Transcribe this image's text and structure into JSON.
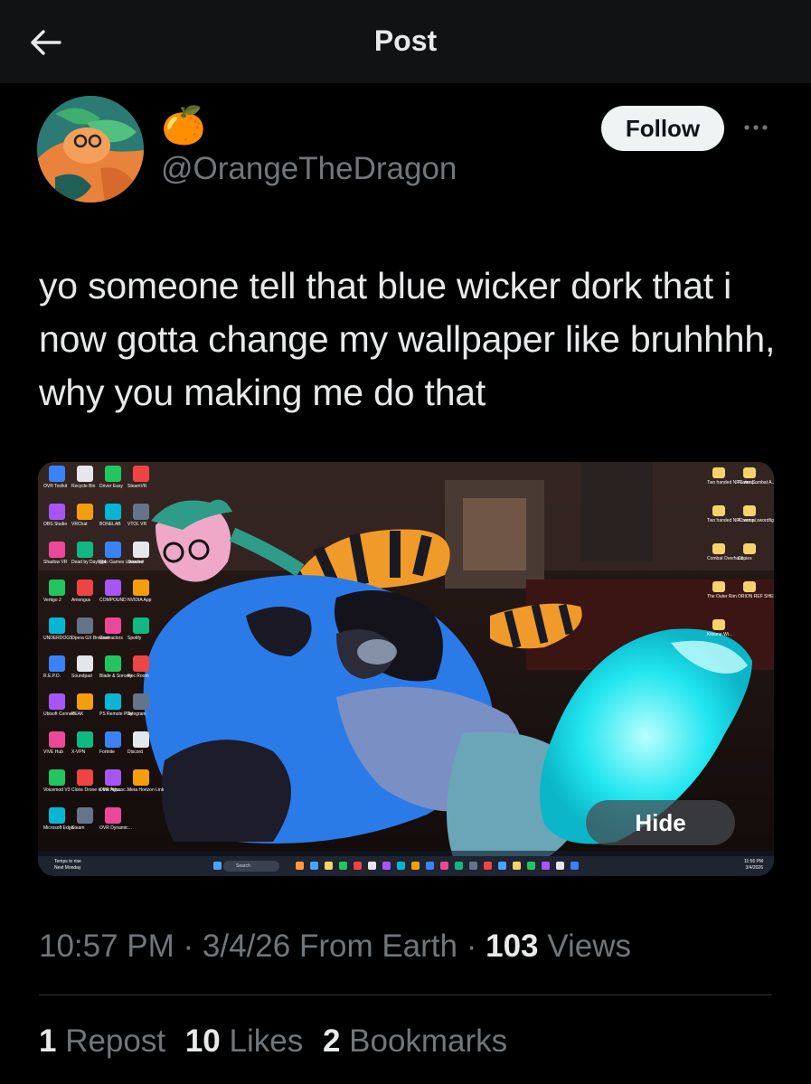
{
  "header": {
    "title": "Post",
    "back_icon": "arrow-left-icon"
  },
  "author": {
    "display_emoji": "🍊",
    "handle": "@OrangeTheDragon",
    "follow_label": "Follow",
    "more_icon": "more-horizontal-icon"
  },
  "post": {
    "text": "yo someone tell that blue wicker dork that i now gotta change my wallpaper like bruhhhh, why you making me do that",
    "media": {
      "hide_label": "Hide",
      "taskbar": {
        "search": "Search",
        "weather_line1": "Temps to rise",
        "weather_line2": "Next Monday",
        "clock_time": "11:56 PM",
        "clock_date": "3/4/2026"
      },
      "desktop_icons_left": [
        [
          "OVR Toolkit",
          "Recycle Bin",
          "Driver Easy",
          "SteamVR"
        ],
        [
          "OBS Studio",
          "VRChat",
          "BONELAB",
          "VTOL VR"
        ],
        [
          "Shadow VR",
          "Dead by Daylight",
          "Epic Games Launcher",
          "Onward"
        ],
        [
          "Vertigo 2",
          "Amongus",
          "COMPOUND",
          "NVIDIA App"
        ],
        [
          "UNDERDOGS",
          "Opera GX Browser",
          "Contractors",
          "Spotify"
        ],
        [
          "R.E.P.O.",
          "Soundpad",
          "Blade & Sorcery",
          "Rec Room"
        ],
        [
          "Ubisoft Connect",
          "PEAK",
          "PS Remote Play",
          "Telegram"
        ],
        [
          "VIVE Hub",
          "X-VPN",
          "Fortnite",
          "Discord"
        ],
        [
          "Voicemod V3",
          "Clone Drone in the Hyp...",
          "OVR Advanc...",
          "Meta Horizon Link"
        ],
        [
          "Microsoft Edge",
          "Steam",
          "OVR Dynamic...",
          ""
        ]
      ],
      "desktop_icons_right": [
        [
          "Two handed NPC weap...",
          "Faster Combat A..."
        ],
        [
          "Two handed NPC weap...",
          "A normal swordfight"
        ],
        [
          "Combat Overhauli...",
          "Copies"
        ],
        [
          "The Outer Rim",
          "ORION REF SHEET"
        ],
        [
          "Kitsune Wi...",
          ""
        ]
      ]
    }
  },
  "meta": {
    "time": "10:57 PM",
    "sep1": " · ",
    "date": "3/4/26",
    "source": " From Earth",
    "sep2": " · ",
    "views_count": "103",
    "views_label": " Views"
  },
  "stats": {
    "reposts_count": "1",
    "reposts_label": " Repost",
    "likes_count": "10",
    "likes_label": " Likes",
    "bookmarks_count": "2",
    "bookmarks_label": " Bookmarks"
  }
}
